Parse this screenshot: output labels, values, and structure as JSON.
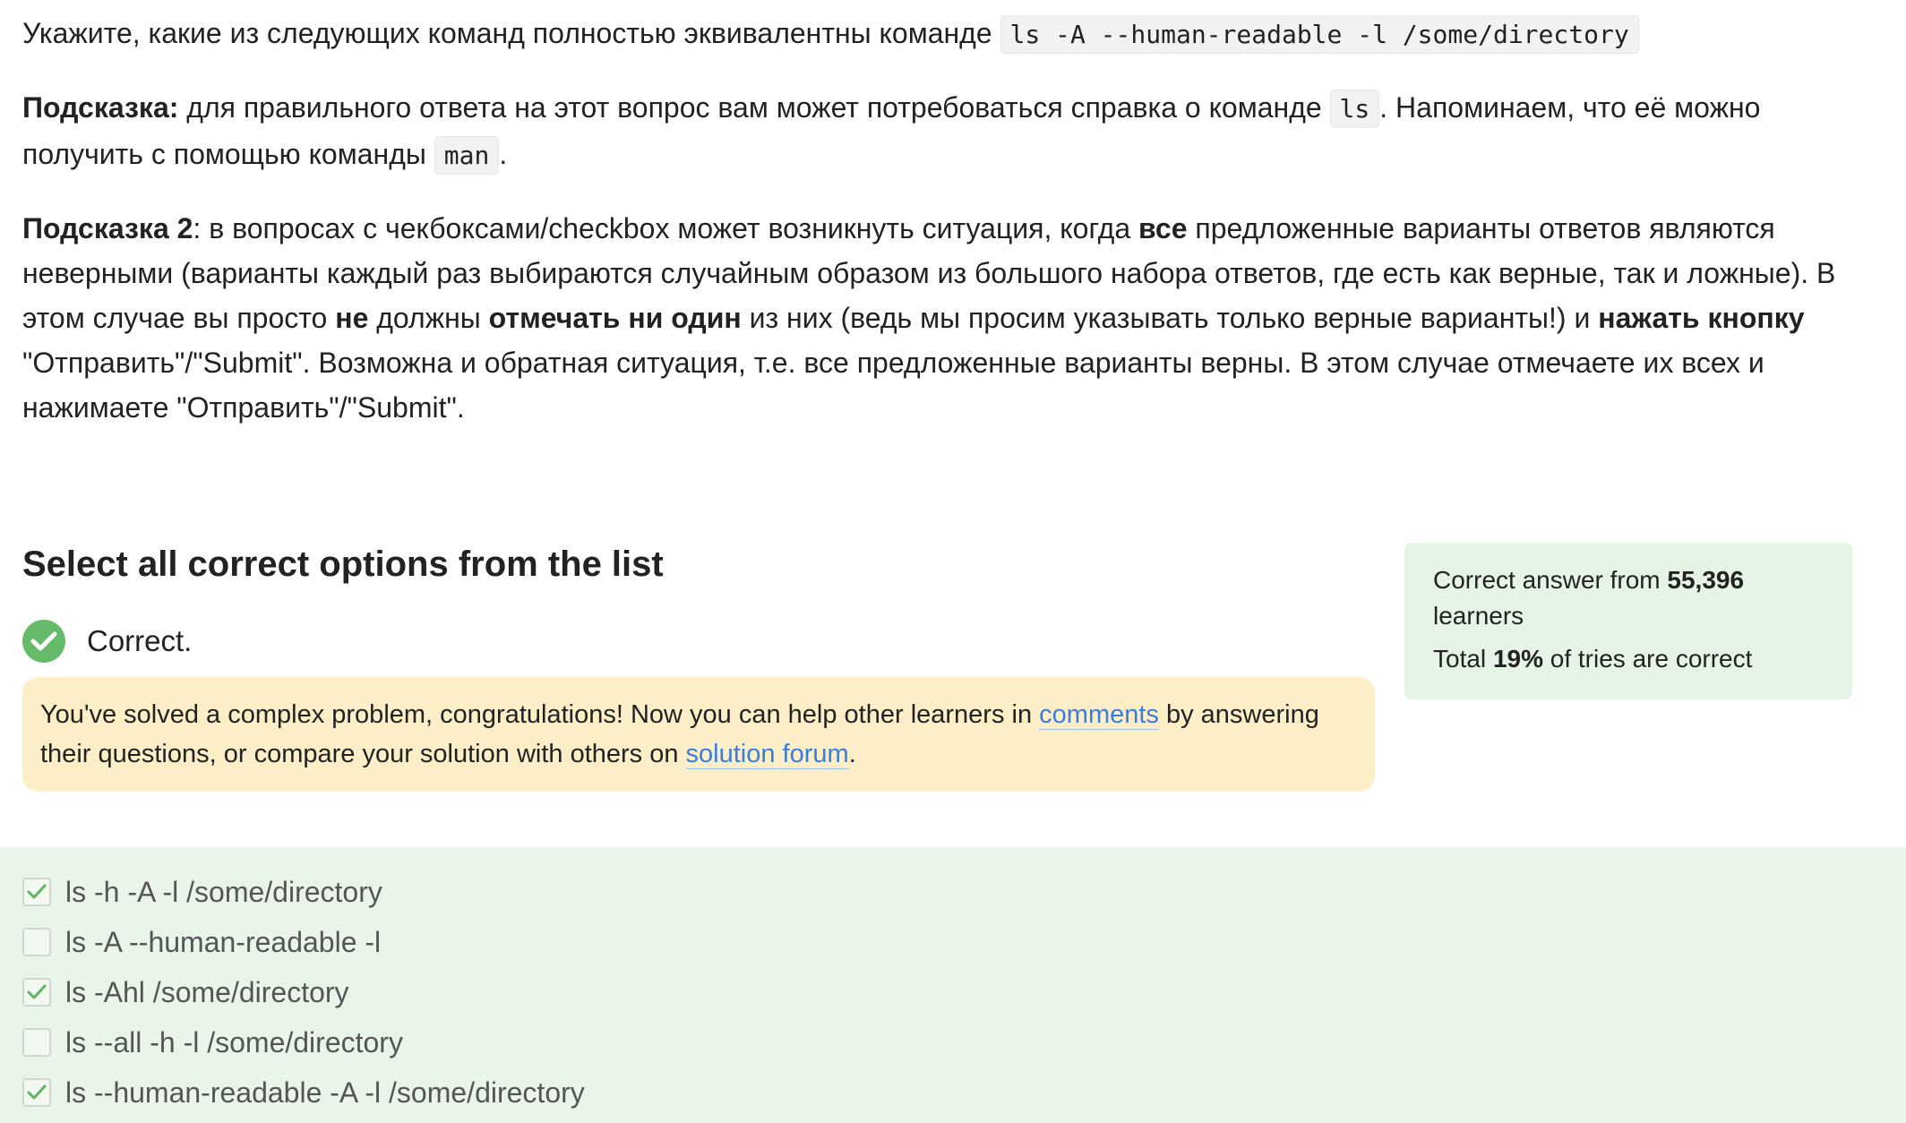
{
  "instructions": {
    "p1": {
      "text": "Укажите, какие из следующих команд полностью эквивалентны команде ",
      "code": "ls -A --human-readable -l /some/directory"
    },
    "p2": {
      "bold": "Подсказка:",
      "text1": " для правильного ответа на этот вопрос вам может потребоваться справка о команде ",
      "code1": "ls",
      "text2": ". Напоминаем, что её можно получить с помощью команды ",
      "code2": "man",
      "text3": "."
    },
    "p3": {
      "bold1": "Подсказка 2",
      "text1": ": в вопросах с чекбоксами/checkbox может возникнуть ситуация, когда ",
      "bold2": "все",
      "text2": " предложенные варианты ответов являются неверными (варианты каждый раз выбираются случайным образом из большого набора ответов, где есть как верные, так и ложные). В этом случае вы просто ",
      "bold3": "не",
      "text3": " должны ",
      "bold4": "отмечать ни один",
      "text4": " из них (ведь мы просим указывать только верные варианты!) и ",
      "bold5": "нажать кнопку",
      "text5": " \"Отправить\"/\"Submit\". Возможна и обратная ситуация, т.е. все предложенные варианты верны. В этом случае отмечаете их всех и нажимаете \"Отправить\"/\"Submit\"."
    }
  },
  "question": {
    "title": "Select all correct options from the list",
    "status": "Correct."
  },
  "congrats": {
    "text1": "You've solved a complex problem, congratulations! Now you can help other learners in ",
    "link1": "comments",
    "text2": " by answering their questions, or compare your solution with others on ",
    "link2": "solution forum",
    "text3": "."
  },
  "stats": {
    "prefix": "Correct answer from ",
    "learners_count": "55,396",
    "suffix": " learners",
    "total_prefix": "Total ",
    "percent": "19%",
    "total_suffix": " of tries are correct"
  },
  "options": [
    {
      "label": "ls -h -A -l /some/directory",
      "checked": true
    },
    {
      "label": "ls -A --human-readable -l",
      "checked": false
    },
    {
      "label": "ls -Ahl /some/directory",
      "checked": true
    },
    {
      "label": "ls --all -h -l /some/directory",
      "checked": false
    },
    {
      "label": "ls --human-readable -A  -l /some/directory",
      "checked": true
    }
  ],
  "colors": {
    "correct_green": "#66bb6a",
    "link_blue": "#3b7ddd",
    "congrats_bg": "#fcefc8",
    "stats_bg": "#e6f4e6",
    "options_bg": "#e9f5e8"
  },
  "icons": {
    "status": "check-circle-icon",
    "checkbox_mark": "checkmark-icon"
  }
}
